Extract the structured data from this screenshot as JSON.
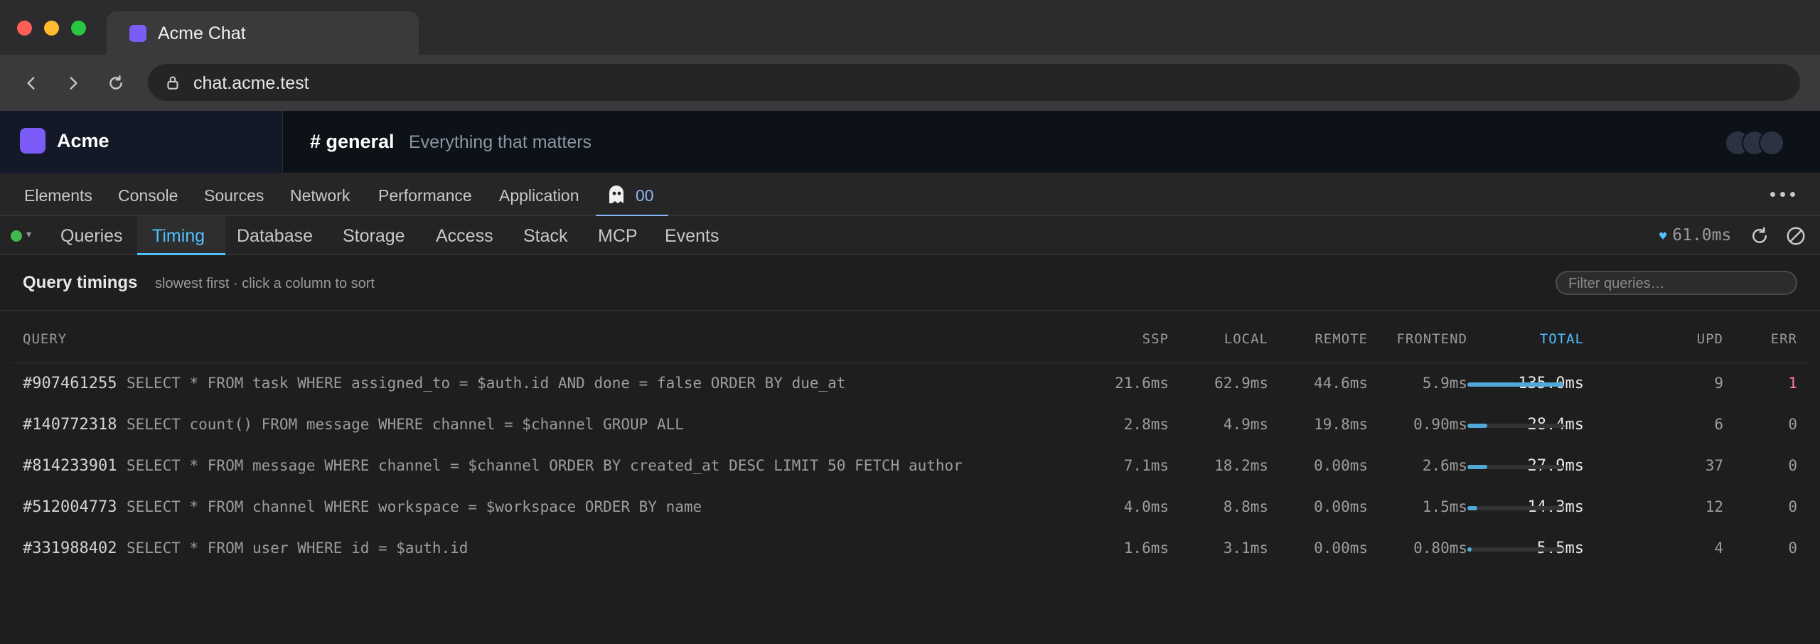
{
  "browser": {
    "tab_title": "Acme Chat",
    "url": "chat.acme.test"
  },
  "app": {
    "workspace_name": "Acme",
    "channel": "# general",
    "channel_description": "Everything that matters",
    "brand_color": "#7c5cf6"
  },
  "devtools": {
    "tabs": [
      "Elements",
      "Console",
      "Sources",
      "Network",
      "Performance",
      "Application"
    ],
    "active_tab_label": "00",
    "sub_tabs": [
      "Queries",
      "Timing",
      "Database",
      "Storage",
      "Access",
      "Stack",
      "MCP",
      "Events"
    ],
    "active_sub_tab": "Timing",
    "heartbeat": "61.0ms",
    "status": "connected",
    "accent_color": "#4fc1ff"
  },
  "panel": {
    "title": "Query timings",
    "subtitle": "slowest first · click a column to sort",
    "filter_placeholder": "Filter queries…"
  },
  "table": {
    "columns": {
      "query": "QUERY",
      "ssp": "SSP",
      "local": "LOCAL",
      "remote": "REMOTE",
      "frontend": "FRONTEND",
      "total": "TOTAL",
      "upd": "UPD",
      "err": "ERR"
    },
    "rows": [
      {
        "id": "#907461255",
        "query": "SELECT * FROM task WHERE assigned_to = $auth.id AND done = false ORDER BY due_at",
        "ssp": "21.6ms",
        "local": "62.9ms",
        "remote": "44.6ms",
        "frontend": "5.9ms",
        "total": "135.0ms",
        "total_fraction": 1.0,
        "upd": "9",
        "err": "1"
      },
      {
        "id": "#140772318",
        "query": "SELECT count() FROM message WHERE channel = $channel GROUP ALL",
        "ssp": "2.8ms",
        "local": "4.9ms",
        "remote": "19.8ms",
        "frontend": "0.90ms",
        "total": "28.4ms",
        "total_fraction": 0.21,
        "upd": "6",
        "err": "0"
      },
      {
        "id": "#814233901",
        "query": "SELECT * FROM message WHERE channel = $channel ORDER BY created_at DESC LIMIT 50 FETCH author",
        "ssp": "7.1ms",
        "local": "18.2ms",
        "remote": "0.00ms",
        "frontend": "2.6ms",
        "total": "27.9ms",
        "total_fraction": 0.207,
        "upd": "37",
        "err": "0"
      },
      {
        "id": "#512004773",
        "query": "SELECT * FROM channel WHERE workspace = $workspace ORDER BY name",
        "ssp": "4.0ms",
        "local": "8.8ms",
        "remote": "0.00ms",
        "frontend": "1.5ms",
        "total": "14.3ms",
        "total_fraction": 0.106,
        "upd": "12",
        "err": "0"
      },
      {
        "id": "#331988402",
        "query": "SELECT * FROM user WHERE id = $auth.id",
        "ssp": "1.6ms",
        "local": "3.1ms",
        "remote": "0.00ms",
        "frontend": "0.80ms",
        "total": "5.5ms",
        "total_fraction": 0.041,
        "upd": "4",
        "err": "0"
      }
    ]
  }
}
